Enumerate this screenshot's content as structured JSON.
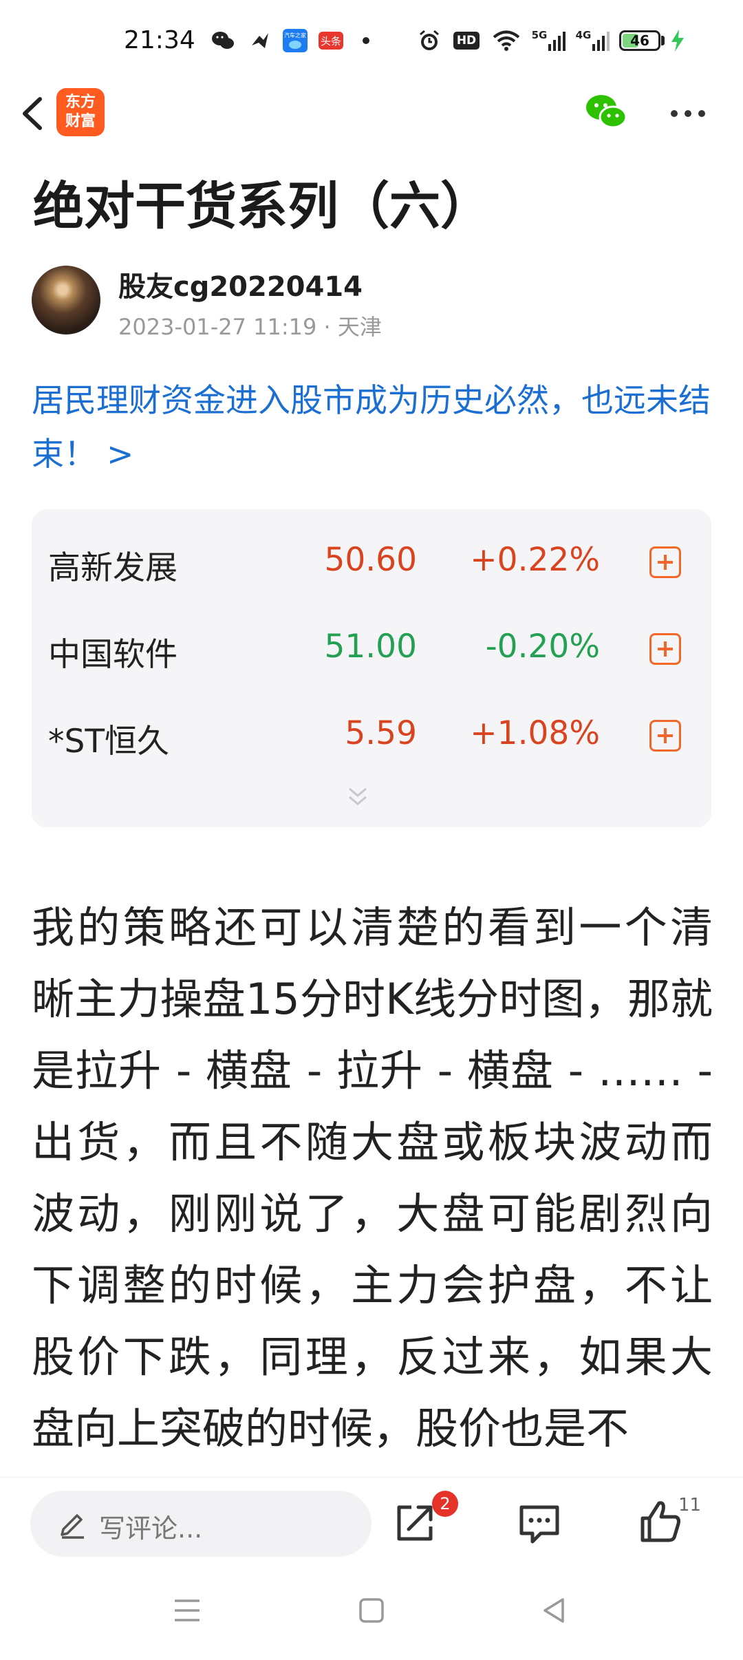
{
  "status_bar": {
    "time": "21:34",
    "icons": [
      "wechat-icon",
      "feishu-icon",
      "autohome-app-icon",
      "toutiao-app-icon",
      "dot-icon",
      "alarm-icon",
      "hd-icon",
      "wifi-icon",
      "5g-signal-icon",
      "4g-signal-icon",
      "battery-icon",
      "charging-icon"
    ],
    "autohome_label": "汽车之家",
    "toutiao_label": "头条",
    "hd_label": "HD",
    "signal1_label": "5G",
    "signal2_label": "4G",
    "battery_level": "46",
    "accent": "#34c759"
  },
  "nav": {
    "logo_line1": "东方",
    "logo_line2": "财富",
    "icons": [
      "back-arrow-icon",
      "wechat-share-icon",
      "more-dots-icon"
    ]
  },
  "article": {
    "title": "绝对干货系列（六）",
    "author": "股友cg20220414",
    "meta": "2023-01-27 11:19 · 天津",
    "headline_link": "居民理财资金进入股市成为历史必然，也远未结束！ >",
    "body": "我的策略还可以清楚的看到一个清晰主力操盘15分时K线分时图，那就是拉升 - 横盘 - 拉升 - 横盘 - …… - 出货，而且不随大盘或板块波动而波动，刚刚说了，大盘可能剧烈向下调整的时候，主力会护盘，不让股价下跌，同理，反过来，如果大盘向上突破的时候，股价也是不"
  },
  "stocks": [
    {
      "name": "高新发展",
      "price": "50.60",
      "change": "+0.22%",
      "trend": "up"
    },
    {
      "name": "中国软件",
      "price": "51.00",
      "change": "-0.20%",
      "trend": "down"
    },
    {
      "name": "*ST恒久",
      "price": "5.59",
      "change": "+1.08%",
      "trend": "up"
    }
  ],
  "colors": {
    "up": "#d9431f",
    "down": "#23a052",
    "link": "#1b6fd2",
    "brand": "#ff5a1f"
  },
  "bottom_bar": {
    "comment_placeholder": "写评论...",
    "share_badge": "2",
    "like_count": "11"
  }
}
